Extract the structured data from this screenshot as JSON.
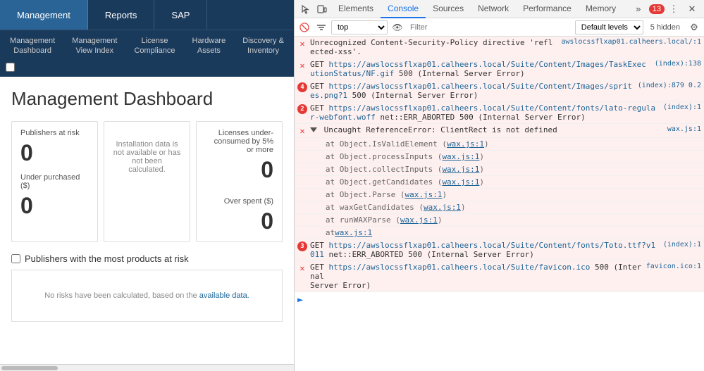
{
  "leftPanel": {
    "topNav": {
      "tabs": [
        {
          "id": "management",
          "label": "Management",
          "active": true
        },
        {
          "id": "reports",
          "label": "Reports",
          "active": false
        },
        {
          "id": "sap",
          "label": "SAP",
          "active": false
        }
      ]
    },
    "subNav": {
      "items": [
        {
          "id": "management-dashboard",
          "label": "Management\nDashboard"
        },
        {
          "id": "management-view-index",
          "label": "Management\nView Index"
        },
        {
          "id": "license-compliance",
          "label": "License\nCompliance"
        },
        {
          "id": "hardware-assets",
          "label": "Hardware\nAssets"
        },
        {
          "id": "discovery-inventory",
          "label": "Discovery &\nInventory"
        }
      ]
    },
    "pageTitle": "Management Dashboard",
    "cards": [
      {
        "id": "publishers-at-risk",
        "label": "Publishers at risk",
        "value": "0",
        "type": "stat"
      },
      {
        "id": "installation-data",
        "label": "Installation data is not available or has not been calculated.",
        "type": "message"
      },
      {
        "id": "licenses-underconsumed",
        "label": "Licenses under-consumed by 5% or more",
        "value": "0",
        "type": "stat-right"
      }
    ],
    "cards2": [
      {
        "id": "under-purchased",
        "label": "Under purchased ($)",
        "value": "0",
        "type": "stat"
      },
      {
        "id": "over-spent",
        "label": "Over spent ($)",
        "value": "0",
        "type": "stat-right"
      }
    ],
    "sectionTitle": "Publishers with the most products at risk",
    "noDataMsg": "No risks have been calculated, based on the",
    "noDataLink": "available data.",
    "noDataLinkUrl": "#"
  },
  "devtools": {
    "tabs": [
      {
        "id": "elements",
        "label": "Elements"
      },
      {
        "id": "console",
        "label": "Console",
        "active": true
      },
      {
        "id": "sources",
        "label": "Sources"
      },
      {
        "id": "network",
        "label": "Network"
      },
      {
        "id": "performance",
        "label": "Performance"
      },
      {
        "id": "memory",
        "label": "Memory"
      }
    ],
    "errorCount": "13",
    "contextSelector": "top",
    "filterPlaceholder": "Filter",
    "levelsLabel": "Default levels",
    "hiddenCount": "5 hidden",
    "messages": [
      {
        "id": "msg1",
        "type": "error",
        "icon": "x",
        "content": "Unrecognized Content-Security-Policy directive 'reflected-xss'.",
        "source": "awslocssflxap01.calheers.local/:1"
      },
      {
        "id": "msg2",
        "type": "error",
        "icon": "x",
        "content": "GET https://awslocssflxap01.calheers.local/Suite/Content/Images/TaskExecutionStatus/NF.gif 500 (Internal Server Error)",
        "source": "(index):138"
      },
      {
        "id": "msg3",
        "type": "error-badge",
        "badge": "4",
        "content": "GET https://awslocssflxap01.calheers.local/Suite/Content/Images/sprites.png?1 500 (Internal Server Error)",
        "source": "(index):879 0.2"
      },
      {
        "id": "msg4",
        "type": "error-badge",
        "badge": "2",
        "content": "GET https://awslocssflxap01.calheers.local/Suite/Content/fonts/lato-regular-webfont.woff net::ERR_ABORTED 500 (Internal Server Error)",
        "source": "(index):1"
      },
      {
        "id": "msg5",
        "type": "error-expandable",
        "icon": "x",
        "expanded": true,
        "content": "Uncaught ReferenceError: ClientRect is not defined",
        "source": "wax.js:1",
        "stack": [
          "at Object.IsValidElement (wax.js:1)",
          "at Object.processInputs (wax.js:1)",
          "at Object.collectInputs (wax.js:1)",
          "at Object.getCandidates (wax.js:1)",
          "at Object.Parse (wax.js:1)",
          "at waxGetCandidates (wax.js:1)",
          "at runWAXParse (wax.js:1)",
          "at wax.js:1"
        ]
      },
      {
        "id": "msg6",
        "type": "error-badge",
        "badge": "3",
        "content": "GET https://awslocssflxap01.calheers.local/Suite/Content/fonts/Toto.ttf?v1011 net::ERR_ABORTED 500 (Internal Server Error)",
        "source": "(index):1"
      },
      {
        "id": "msg7",
        "type": "error",
        "icon": "x",
        "content": "GET https://awslocssflxap01.calheers.local/Suite/favicon.ico 500 (Internal Server Error)",
        "source": "favicon.ico:1"
      }
    ]
  }
}
